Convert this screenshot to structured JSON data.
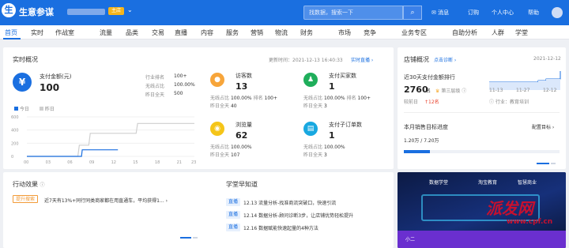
{
  "header": {
    "logo_glyph": "生",
    "brand": "生意参谋",
    "main_badge": "主店",
    "search_placeholder": "找数据，搜索一下",
    "search_icon": "search-icon",
    "message": "消息",
    "subscribe": "订购",
    "personal": "个人中心",
    "help": "帮助"
  },
  "nav": {
    "items": [
      "首页",
      "实时",
      "作战室",
      "流量",
      "品类",
      "交易",
      "直播",
      "内容",
      "服务",
      "营销",
      "物流",
      "财务",
      "市场",
      "竞争",
      "业务专区",
      "自助分析",
      "人群",
      "学堂"
    ],
    "active": "首页"
  },
  "realtime": {
    "title": "实时概况",
    "update_time": "更新时间：2021-12-13 16:40:33",
    "link": "实时直播",
    "pay_label": "支付金额(元)",
    "pay_value": "100",
    "rank_label": "行业排名",
    "rank_value": "100+",
    "wireless_label": "无线占比",
    "wireless_value": "100.00%",
    "yday_label": "昨日全天",
    "yday_value": "500",
    "legend_today": "今日",
    "legend_yesterday": "昨日",
    "metrics": [
      {
        "label": "访客数",
        "value": "13",
        "l1": "无线占比",
        "v1": "100.00%",
        "l2": "排名",
        "v2": "100+",
        "l3": "昨日全天",
        "v3": "40"
      },
      {
        "label": "支付买家数",
        "value": "1",
        "l1": "无线占比",
        "v1": "100.00%",
        "l2": "排名",
        "v2": "100+",
        "l3": "昨日全天",
        "v3": "3"
      },
      {
        "label": "浏览量",
        "value": "62",
        "l1": "无线占比",
        "v1": "100.00%",
        "l2": "",
        "v2": "",
        "l3": "昨日全天",
        "v3": "107"
      },
      {
        "label": "支付子订单数",
        "value": "1",
        "l1": "无线占比",
        "v1": "100.00%",
        "l2": "",
        "v2": "",
        "l3": "昨日全天",
        "v3": "3"
      }
    ],
    "chart_data": {
      "type": "line",
      "x": [
        "00",
        "03",
        "06",
        "09",
        "12",
        "15",
        "18",
        "21"
      ],
      "ylim": [
        0,
        600
      ],
      "y_ticks": [
        "600",
        "400",
        "200",
        "0"
      ],
      "series": [
        {
          "name": "今日",
          "color": "#1a6fe0",
          "points": [
            [
              0,
              0
            ],
            [
              7.5,
              0
            ],
            [
              7.6,
              100
            ],
            [
              12,
              100
            ],
            [
              12.5,
              100
            ]
          ]
        },
        {
          "name": "昨日",
          "color": "#cfcfcf",
          "points": [
            [
              0,
              0
            ],
            [
              7,
              0
            ],
            [
              7.2,
              170
            ],
            [
              8.5,
              170
            ],
            [
              8.7,
              350
            ],
            [
              15,
              350
            ],
            [
              15.2,
              500
            ],
            [
              23,
              500
            ]
          ]
        }
      ],
      "x_end": "23"
    }
  },
  "shop": {
    "title": "店铺概况",
    "link": "点击诊断",
    "date": "2021-12-12",
    "rank_title": "近30天支付金额排行",
    "rank_value": "2760",
    "rank_unit": "名",
    "tier": "第三层级",
    "change_label": "较前日",
    "change_value": "12名",
    "industry": "行业：教育培训",
    "mini_x": [
      "11-13",
      "11-27",
      "12-12"
    ],
    "target_title": "本月销售目标进度",
    "target_link": "配置目标",
    "target_value": "1.20万 / 7.20万",
    "target_pct": 16.7
  },
  "effect": {
    "title": "行动效果",
    "chip": "提升搜索",
    "text": "近7天有13%+同行同类商家都在用直通车，平均获得1..."
  },
  "school": {
    "title": "学堂早知道",
    "chip": "直播",
    "items": [
      "12.13 流量分析-找准商流突破口，快速引流",
      "12.14 数据分析-顾问诊断3步，让店铺优势轻松提升",
      "12.16 数据赋能快速起量的4种方法"
    ]
  },
  "ad": {
    "logos": [
      "数据学堂",
      "淘宝教育",
      "智慧商业"
    ],
    "bottom": "小二",
    "watermark": "www.cpf.cn",
    "watermark_big": "派发网"
  }
}
